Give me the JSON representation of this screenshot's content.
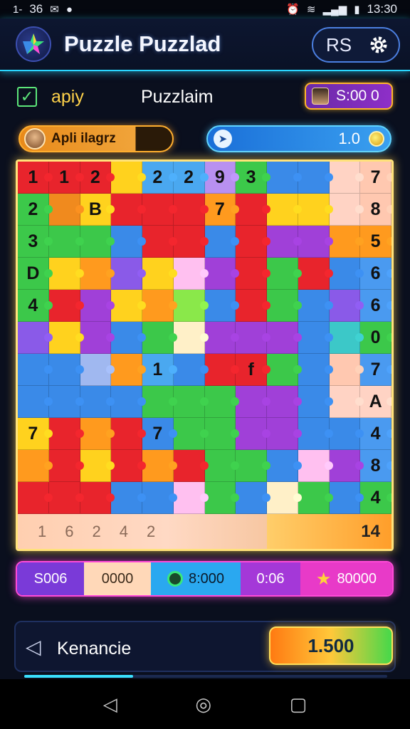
{
  "status_bar": {
    "left_a": "1-",
    "time_left": "36",
    "time_right": "13:30"
  },
  "header": {
    "title": "Puzzle Puzzlad",
    "user_initials": "RS"
  },
  "subheader": {
    "check_label": "apiy",
    "center_title": "Puzzlaim",
    "score": "S:00 0"
  },
  "player": {
    "name": "Apli ilagrz"
  },
  "level": {
    "value": "1.0"
  },
  "board": {
    "rows": [
      [
        "1",
        "1",
        "2",
        "",
        "2",
        "2",
        "9",
        "3",
        "",
        "",
        "",
        "7"
      ],
      [
        "2",
        "",
        "B",
        "",
        "",
        "",
        "7",
        "",
        "",
        "",
        "",
        "8"
      ],
      [
        "3",
        "",
        "",
        "",
        "",
        "",
        "",
        "",
        "",
        "",
        "",
        "5"
      ],
      [
        "D",
        "",
        "",
        "",
        "",
        "",
        "",
        "",
        "",
        "",
        "",
        "6"
      ],
      [
        "4",
        "",
        "",
        "",
        "",
        "",
        "",
        "",
        "",
        "",
        "",
        "6"
      ],
      [
        "",
        "",
        "",
        "",
        "",
        "",
        "",
        "",
        "",
        "",
        "",
        "0"
      ],
      [
        "",
        "",
        "",
        "",
        "1",
        "",
        "",
        "f",
        "",
        "",
        "",
        "7"
      ],
      [
        "",
        "",
        "",
        "",
        "",
        "",
        "",
        "",
        "",
        "",
        "",
        "A"
      ],
      [
        "7",
        "",
        "",
        "",
        "7",
        "",
        "",
        "",
        "",
        "",
        "",
        "4"
      ],
      [
        "",
        "",
        "",
        "",
        "",
        "",
        "",
        "",
        "",
        "",
        "",
        "8"
      ],
      [
        "",
        "",
        "",
        "",
        "",
        "",
        "",
        "",
        "",
        "",
        "",
        "4"
      ]
    ],
    "colors": [
      [
        "#e8242c",
        "#e8242c",
        "#e8242c",
        "#ffd21e",
        "#4aa8f0",
        "#4aa8f0",
        "#b890f0",
        "#3cc84a",
        "#3a8ae8",
        "#3a8ae8",
        "#ffd3c4",
        "#ffc8b0"
      ],
      [
        "#3cc84a",
        "#f08a1e",
        "#ffd21e",
        "#e8242c",
        "#e8242c",
        "#e8242c",
        "#ff9a1e",
        "#e8242c",
        "#ffd21e",
        "#ffd21e",
        "#ffd3c4",
        "#ffc8b0"
      ],
      [
        "#3cc84a",
        "#3cc84a",
        "#3cc84a",
        "#3a8ae8",
        "#e8242c",
        "#e8242c",
        "#3a8ae8",
        "#e8242c",
        "#a040d8",
        "#a040d8",
        "#ff9a1e",
        "#ff9a1e"
      ],
      [
        "#3cc84a",
        "#ffd21e",
        "#ff9a1e",
        "#8a5ae8",
        "#ffd21e",
        "#ffc0f0",
        "#a040d8",
        "#e8242c",
        "#3cc84a",
        "#e8242c",
        "#3a8ae8",
        "#4a9af0"
      ],
      [
        "#3cc84a",
        "#e8242c",
        "#a040d8",
        "#ffd21e",
        "#ff9a1e",
        "#8ae84a",
        "#3a8ae8",
        "#e8242c",
        "#3cc84a",
        "#3a8ae8",
        "#8a5ae8",
        "#4a9af0"
      ],
      [
        "#8a5ae8",
        "#ffd21e",
        "#a040d8",
        "#3a8ae8",
        "#3cc84a",
        "#fff0c8",
        "#a040d8",
        "#a040d8",
        "#a040d8",
        "#3a8ae8",
        "#3cc8c8",
        "#3cc84a"
      ],
      [
        "#3a8ae8",
        "#3a8ae8",
        "#a0b8f0",
        "#ff9a1e",
        "#4aa8f0",
        "#3a8ae8",
        "#e8242c",
        "#e8242c",
        "#3cc84a",
        "#3a8ae8",
        "#ffc8b0",
        "#4a9af0"
      ],
      [
        "#3a8ae8",
        "#3a8ae8",
        "#3a8ae8",
        "#3a8ae8",
        "#3cc84a",
        "#3cc84a",
        "#3cc84a",
        "#a040d8",
        "#a040d8",
        "#3a8ae8",
        "#ffd3c4",
        "#ffd3c4"
      ],
      [
        "#ffd21e",
        "#e8242c",
        "#ff9a1e",
        "#e8242c",
        "#3a8ae8",
        "#3cc84a",
        "#3cc84a",
        "#a040d8",
        "#a040d8",
        "#3a8ae8",
        "#3a8ae8",
        "#4a9af0"
      ],
      [
        "#ff9a1e",
        "#e8242c",
        "#ffd21e",
        "#e8242c",
        "#ff9a1e",
        "#e8242c",
        "#3cc84a",
        "#3cc84a",
        "#3a8ae8",
        "#ffc0f0",
        "#a040d8",
        "#4a9af0"
      ],
      [
        "#e8242c",
        "#e8242c",
        "#e8242c",
        "#3a8ae8",
        "#3a8ae8",
        "#ffc0f0",
        "#3cc84a",
        "#3a8ae8",
        "#fff0c8",
        "#3cc84a",
        "#3a8ae8",
        "#3cc84a"
      ]
    ],
    "bottom_left": [
      "1",
      "6",
      "2",
      "4",
      "2"
    ],
    "bottom_right": "14"
  },
  "stats": {
    "s1": "S006",
    "s2": "0000",
    "s3": "8:000",
    "s4": "0:06",
    "s5": "80000"
  },
  "footer": {
    "label": "Kenancie",
    "action": "1.500",
    "progress": 0.3
  }
}
